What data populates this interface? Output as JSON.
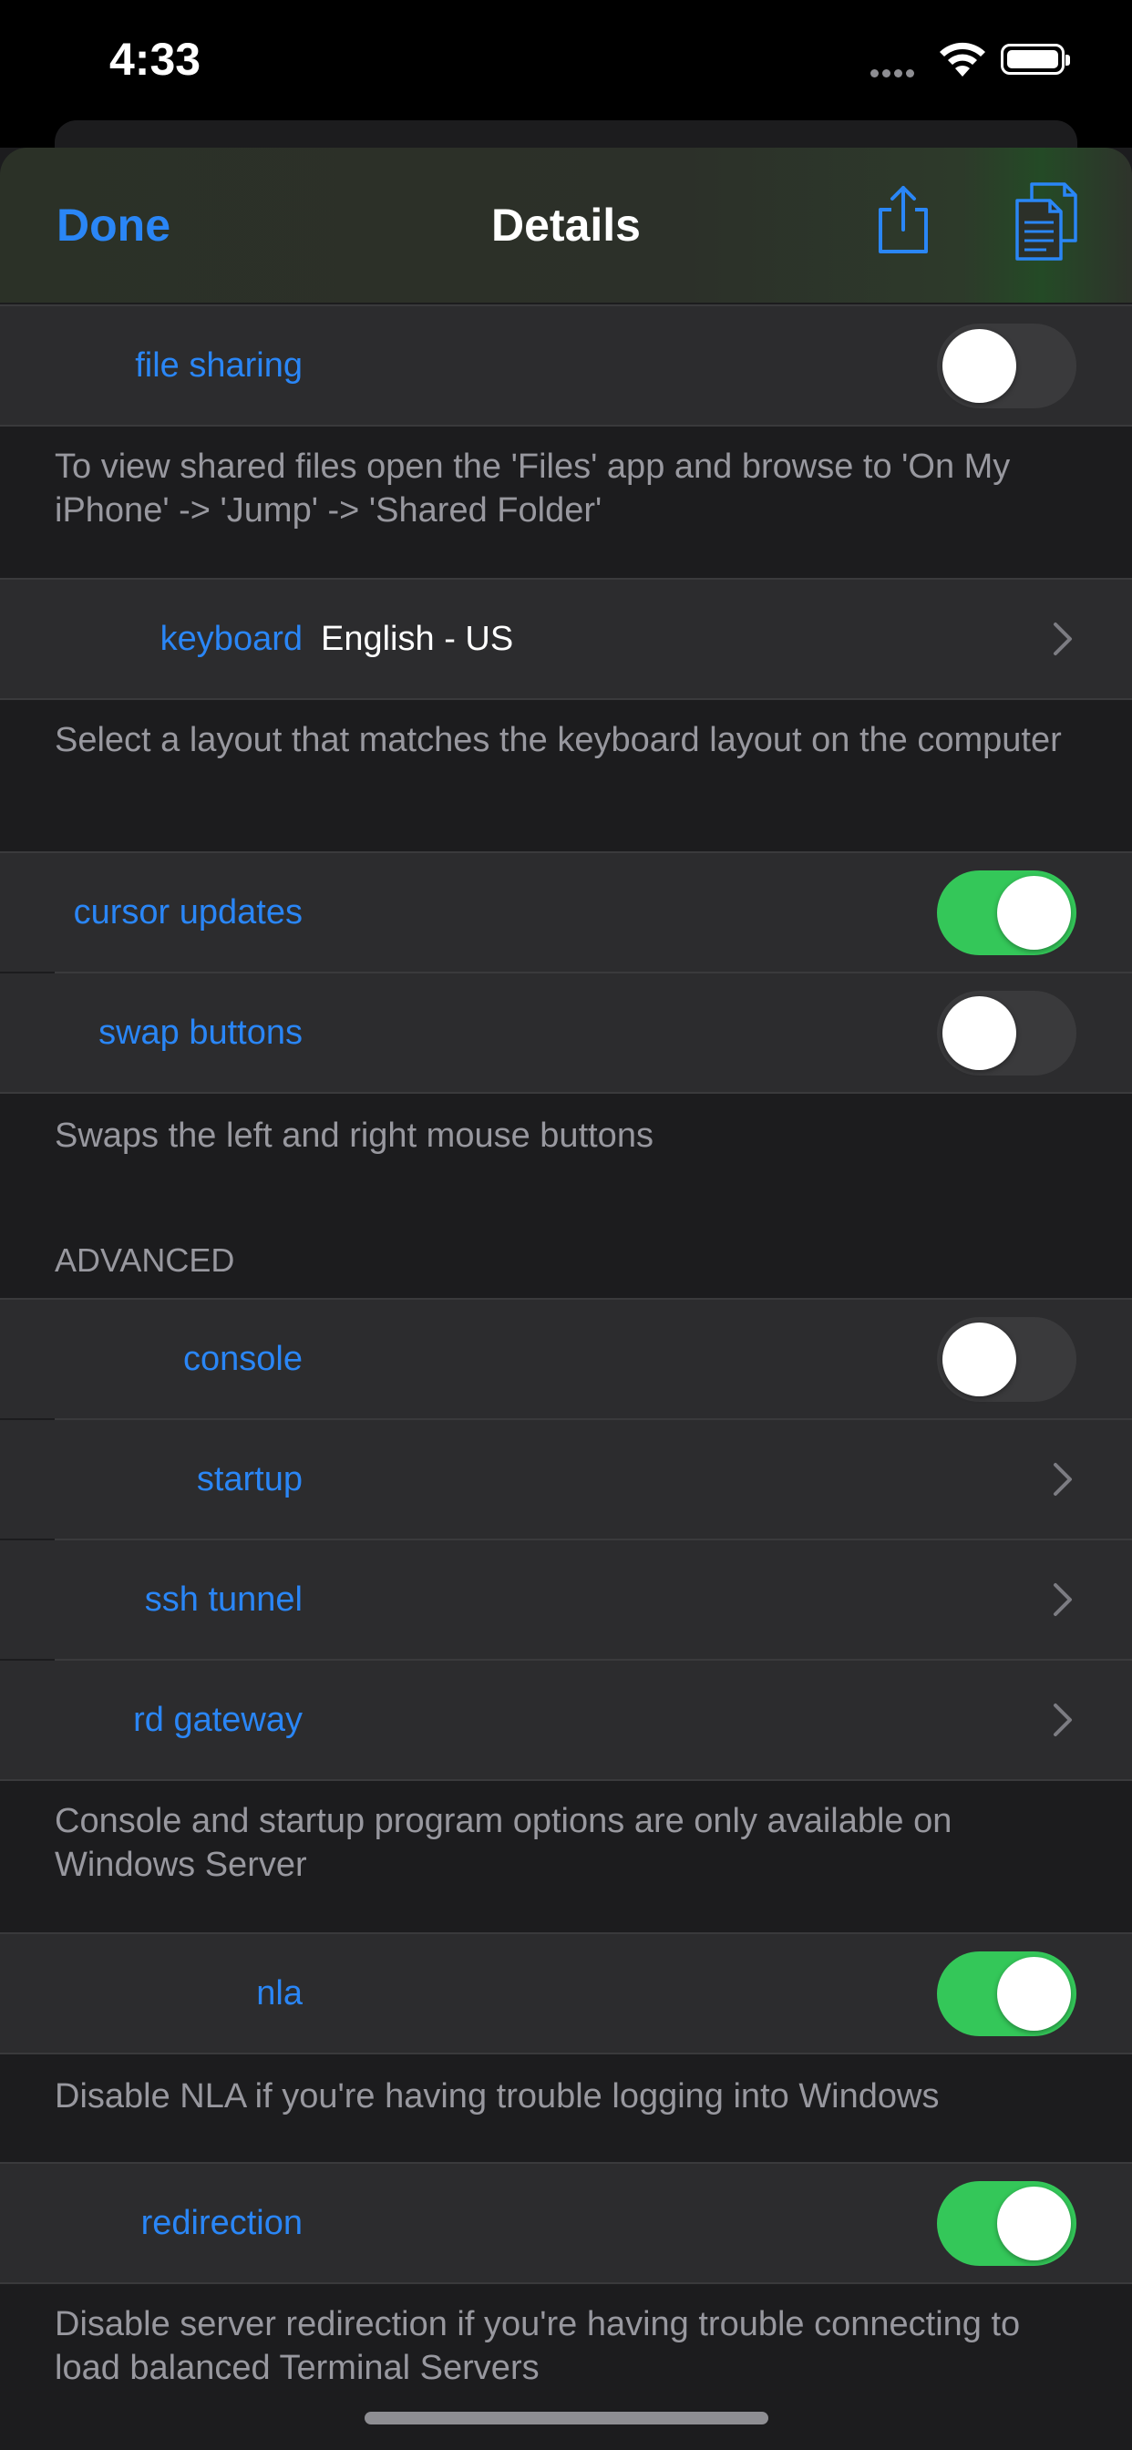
{
  "status_bar": {
    "time": "4:33"
  },
  "nav": {
    "done_label": "Done",
    "title": "Details"
  },
  "rows": {
    "file_sharing": {
      "label": "file sharing",
      "on": false
    },
    "keyboard": {
      "label": "keyboard",
      "value": "English - US"
    },
    "cursor_updates": {
      "label": "cursor updates",
      "on": true
    },
    "swap_buttons": {
      "label": "swap buttons",
      "on": false
    },
    "console": {
      "label": "console",
      "on": false
    },
    "startup": {
      "label": "startup"
    },
    "ssh_tunnel": {
      "label": "ssh tunnel"
    },
    "rd_gateway": {
      "label": "rd gateway"
    },
    "nla": {
      "label": "nla",
      "on": true
    },
    "redirection": {
      "label": "redirection",
      "on": true
    }
  },
  "footers": {
    "file_sharing": "To view shared files open the 'Files' app and browse to 'On My iPhone' -> 'Jump' -> 'Shared Folder'",
    "keyboard": "Select a layout that matches the keyboard layout on the computer",
    "swap_buttons": "Swaps the left and right mouse buttons",
    "advanced": "Console and startup program options are only available on Windows Server",
    "nla": "Disable NLA if you're having trouble logging into Windows",
    "redirection": "Disable server redirection if you're having trouble connecting to load balanced Terminal Servers"
  },
  "sections": {
    "advanced_header": "ADVANCED"
  },
  "colors": {
    "accent": "#2a86f6",
    "toggle_on": "#34c759",
    "toggle_off": "#3a3a3c",
    "cell": "#2c2c2e",
    "background": "#1c1c1e"
  }
}
